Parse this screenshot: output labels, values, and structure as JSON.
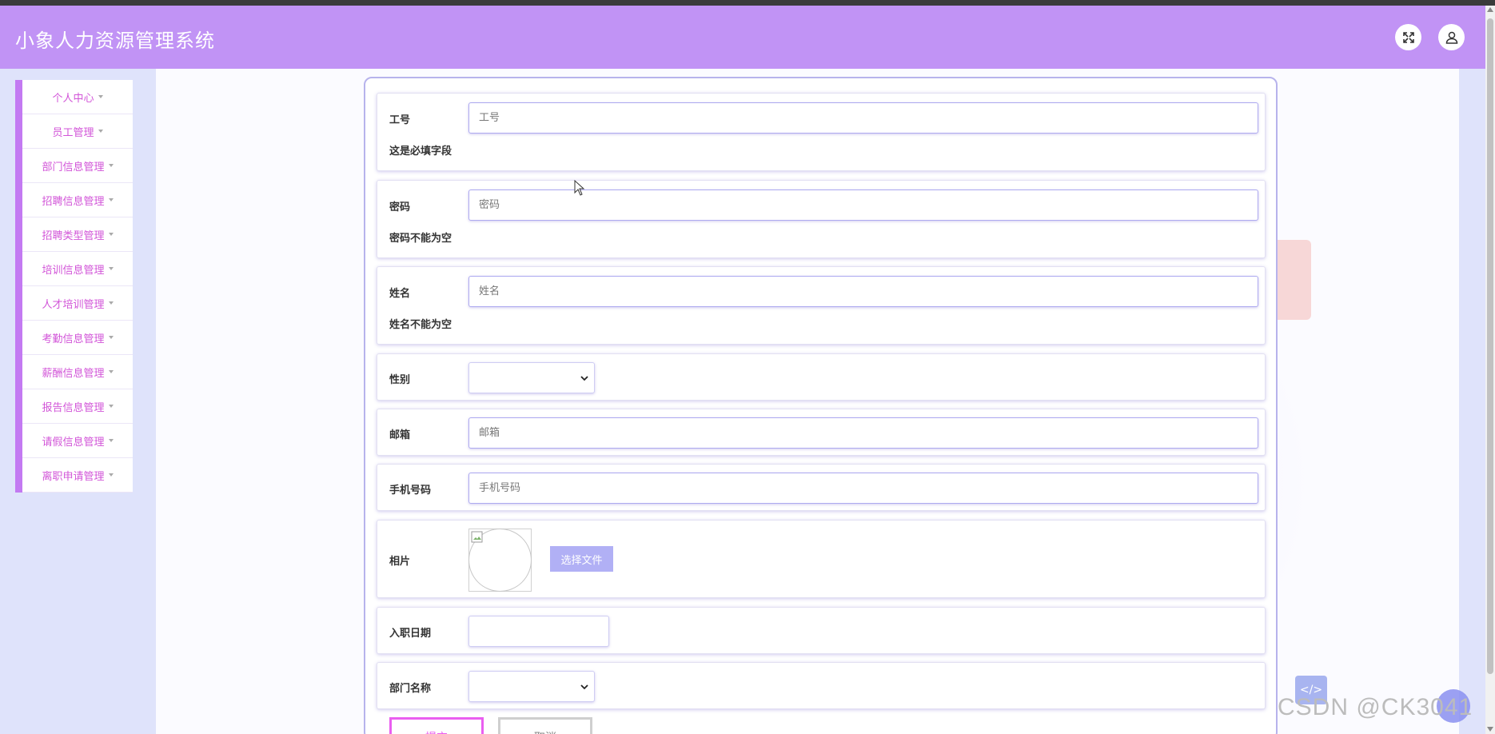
{
  "app": {
    "title": "小象人力资源管理系统"
  },
  "header": {
    "fullscreen_icon": "expand-icon",
    "user_icon": "user-icon"
  },
  "sidebar": {
    "items": [
      {
        "label": "个人中心"
      },
      {
        "label": "员工管理"
      },
      {
        "label": "部门信息管理"
      },
      {
        "label": "招聘信息管理"
      },
      {
        "label": "招聘类型管理"
      },
      {
        "label": "培训信息管理"
      },
      {
        "label": "人才培训管理"
      },
      {
        "label": "考勤信息管理"
      },
      {
        "label": "薪酬信息管理"
      },
      {
        "label": "报告信息管理"
      },
      {
        "label": "请假信息管理"
      },
      {
        "label": "离职申请管理"
      }
    ]
  },
  "form": {
    "employee_id": {
      "label": "工号",
      "placeholder": "工号",
      "value": "",
      "hint": "这是必填字段"
    },
    "password": {
      "label": "密码",
      "placeholder": "密码",
      "value": "",
      "hint": "密码不能为空"
    },
    "name": {
      "label": "姓名",
      "placeholder": "姓名",
      "value": "",
      "hint": "姓名不能为空"
    },
    "gender": {
      "label": "性别",
      "selected": ""
    },
    "email": {
      "label": "邮箱",
      "placeholder": "邮箱",
      "value": ""
    },
    "phone": {
      "label": "手机号码",
      "placeholder": "手机号码",
      "value": ""
    },
    "photo": {
      "label": "相片",
      "button_label": "选择文件"
    },
    "hire_date": {
      "label": "入职日期",
      "value": ""
    },
    "department": {
      "label": "部门名称",
      "selected": ""
    },
    "submit_label": "提交",
    "cancel_label": "取消"
  },
  "watermark": "CSDN @CK3041",
  "colors": {
    "header": "#c193f5",
    "sidebar_accent": "#c37af2",
    "sidebar_text": "#d255d8",
    "input_border": "#aeaaf0",
    "file_button": "#b1b0f5",
    "submit_border": "#ea5ef0"
  }
}
